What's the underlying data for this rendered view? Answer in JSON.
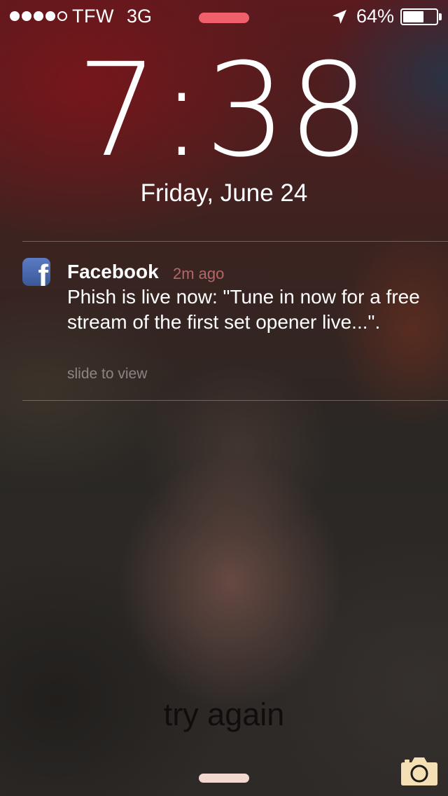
{
  "status_bar": {
    "carrier": "TFW",
    "network": "3G",
    "battery_percent": "64%",
    "battery_level": 0.64,
    "signal_bars_filled": 4,
    "signal_bars_total": 5
  },
  "lock_screen": {
    "time": "7:38",
    "date": "Friday, June 24",
    "status_text": "try again"
  },
  "notification": {
    "app": "Facebook",
    "time_ago": "2m ago",
    "message": "Phish is live now: \"Tune in now for a free stream of the first set opener live...\".",
    "hint": "slide to view",
    "icon": "facebook-icon"
  },
  "icons": {
    "location": "location-arrow-icon",
    "camera": "camera-icon"
  },
  "colors": {
    "status_pill": "#f0606a",
    "facebook_blue": "#3b5998",
    "time_ago": "#d27878"
  }
}
